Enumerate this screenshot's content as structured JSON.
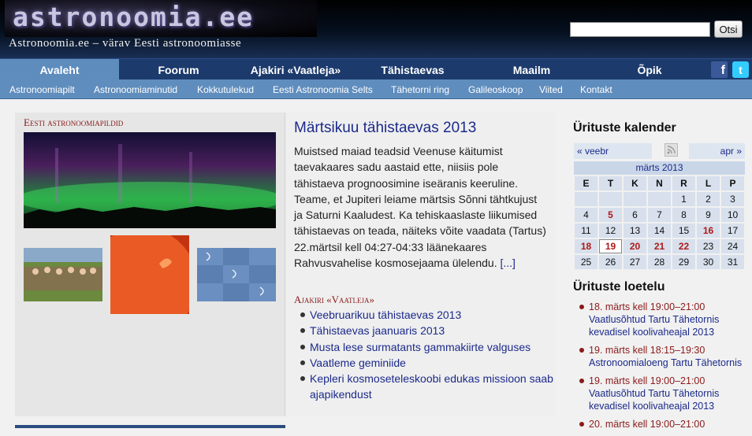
{
  "header": {
    "logo_text": "astronoomia.ee",
    "tagline": "Astronoomia.ee – värav Eesti astronoomiasse",
    "search": {
      "placeholder": "",
      "button_label": "Otsi"
    }
  },
  "main_nav": {
    "items": [
      "Avaleht",
      "Foorum",
      "Ajakiri «Vaatleja»",
      "Tähistaevas",
      "Maailm",
      "Õpik"
    ],
    "active": "Avaleht",
    "facebook_glyph": "f",
    "twitter_glyph": "t"
  },
  "sub_nav": {
    "items": [
      "Astronoomiapilt",
      "Astronoomiaminutid",
      "Kokkutulekud",
      "Eesti Astronoomia Selts",
      "Tähetorni ring",
      "Galileoskoop",
      "Viited",
      "Kontakt"
    ]
  },
  "gallery": {
    "title": "Eesti astronoomiapildid"
  },
  "article": {
    "title": "Märtsikuu tähistaevas 2013",
    "body": "Muistsed maiad teadsid Veenuse käitumist taevakaares sadu aastaid ette, niisiis pole tähistaeva prognoosimine iseäranis keeruline. Teame, et Jupiteri leiame märtsis Sõnni tähtkujust ja Saturni Kaaludest. Ka tehiskaaslaste liikumised tähistaevas on teada, näiteks võite vaadata (Tartus) 22.märtsil kell 04:27-04:33 läänekaares Rahvusvahelise kosmosejaama ülelendu.",
    "more": "[...]"
  },
  "magazine": {
    "title": "Ajakiri «Vaatleja»",
    "items": [
      "Veebruarikuu tähistaevas 2013",
      "Tähistaevas jaanuaris 2013",
      "Musta lese surmatants gammakiirte valguses",
      "Vaatleme geminiide",
      "Kepleri kosmoseteleskoobi edukas missioon saab ajapikendust"
    ]
  },
  "calendar": {
    "heading": "Ürituste kalender",
    "prev": "« veebr",
    "next": "apr »",
    "month": "märts 2013",
    "weekdays": [
      "E",
      "T",
      "K",
      "N",
      "R",
      "L",
      "P"
    ],
    "weeks": [
      [
        "",
        "",
        "",
        "",
        "1",
        "2",
        "3"
      ],
      [
        "4",
        "5",
        "6",
        "7",
        "8",
        "9",
        "10"
      ],
      [
        "11",
        "12",
        "13",
        "14",
        "15",
        "16",
        "17"
      ],
      [
        "18",
        "19",
        "20",
        "21",
        "22",
        "23",
        "24"
      ],
      [
        "25",
        "26",
        "27",
        "28",
        "29",
        "30",
        "31"
      ]
    ],
    "event_days": [
      "5",
      "16",
      "18",
      "19",
      "20",
      "21",
      "22"
    ],
    "today": "19"
  },
  "events": {
    "heading": "Ürituste loetelu",
    "items": [
      {
        "time": "18. märts kell 19:00–21:00",
        "title": "Vaatlusõhtud Tartu Tähetornis kevadisel koolivaheajal 2013"
      },
      {
        "time": "19. märts kell 18:15–19:30",
        "title": "Astronoomialoeng Tartu Tähetornis"
      },
      {
        "time": "19. märts kell 19:00–21:00",
        "title": "Vaatlusõhtud Tartu Tähetornis kevadisel koolivaheajal 2013"
      },
      {
        "time": "20. märts kell 19:00–21:00",
        "title": ""
      }
    ]
  },
  "colors": {
    "nav_dark": "#1c3a6c",
    "nav_active": "#5e8cbd",
    "link": "#1b2a8a",
    "accent_red": "#8b1a1a"
  }
}
